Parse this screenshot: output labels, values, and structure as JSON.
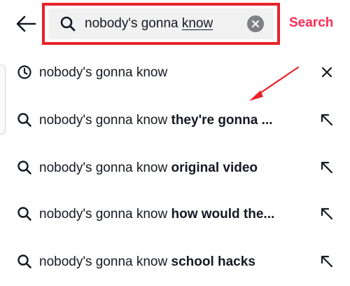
{
  "header": {
    "back_icon": "arrow-left-icon",
    "search_query_plain": "nobody's gonna ",
    "search_query_underlined": "know",
    "search_icon": "search-icon",
    "clear_icon": "clear-circle-icon",
    "search_button": "Search",
    "accent_color": "#fe2c55",
    "highlight_border_color": "#e8222a"
  },
  "suggestions": [
    {
      "icon": "history-clock-icon",
      "base": "nobody's gonna know",
      "bold": "",
      "trail_icon": "remove-x-icon"
    },
    {
      "icon": "search-icon",
      "base": "nobody's gonna know ",
      "bold": "they're gonna ...",
      "trail_icon": "fill-arrow-icon"
    },
    {
      "icon": "search-icon",
      "base": "nobody's gonna know ",
      "bold": "original video",
      "trail_icon": "fill-arrow-icon"
    },
    {
      "icon": "search-icon",
      "base": "nobody's gonna know ",
      "bold": "how would the...",
      "trail_icon": "fill-arrow-icon"
    },
    {
      "icon": "search-icon",
      "base": "nobody's gonna know ",
      "bold": "school hacks",
      "trail_icon": "fill-arrow-icon"
    }
  ],
  "annotation": {
    "arrow_color": "#e8222a"
  }
}
